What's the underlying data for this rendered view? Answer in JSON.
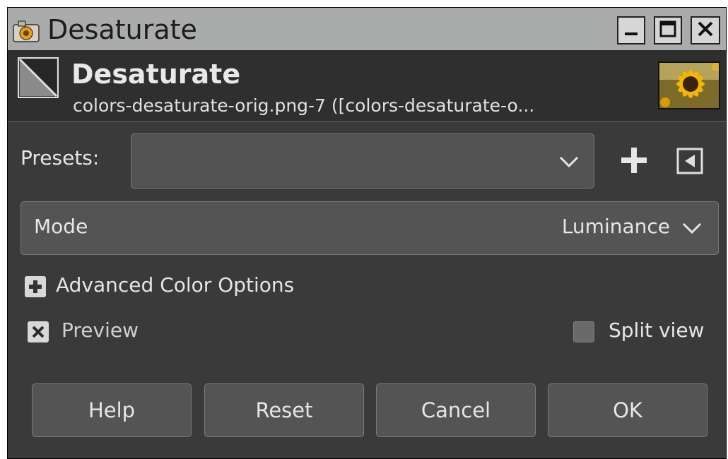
{
  "window": {
    "title": "Desaturate",
    "controls": [
      "minimize-icon",
      "maximize-icon",
      "close-icon"
    ]
  },
  "header": {
    "title": "Desaturate",
    "subtitle": "colors-desaturate-orig.png-7 ([colors-desaturate-o...",
    "icons": [
      "desaturate-filter-icon",
      "image-thumbnail"
    ]
  },
  "presets": {
    "label": "Presets:",
    "value": "",
    "icons": [
      "chevron-down-icon",
      "add-icon",
      "menu-arrow-icon"
    ]
  },
  "mode": {
    "label": "Mode",
    "value": "Luminance"
  },
  "advanced": {
    "label": "Advanced Color Options",
    "expanded": false
  },
  "preview": {
    "label": "Preview",
    "checked": true
  },
  "split_view": {
    "label": "Split view",
    "checked": false
  },
  "buttons": {
    "help": "Help",
    "reset": "Reset",
    "cancel": "Cancel",
    "ok": "OK"
  },
  "colors": {
    "titlebar": "#a9acaa",
    "dialog_bg": "#3b3a3a",
    "header_bg": "#2f2f2f",
    "control_bg": "#545454",
    "text": "#e6e6e6"
  }
}
